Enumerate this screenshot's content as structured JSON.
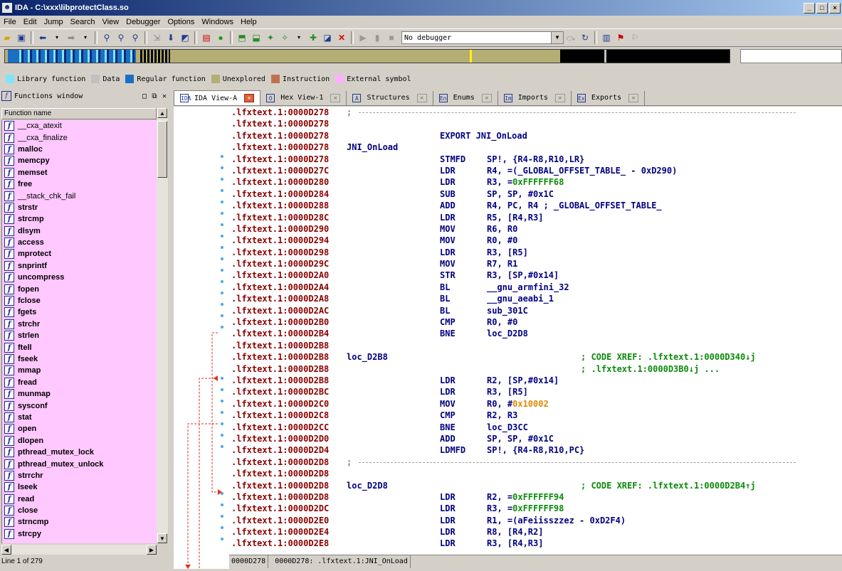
{
  "window": {
    "title": "IDA - C:\\xxx\\libprotectClass.so",
    "minimize": "_",
    "restore": "□",
    "close": "×"
  },
  "menu": [
    "File",
    "Edit",
    "Jump",
    "Search",
    "View",
    "Debugger",
    "Options",
    "Windows",
    "Help"
  ],
  "toolbar": {
    "debugger_value": "No debugger"
  },
  "legend": [
    {
      "label": "Library function",
      "color": "#7fe5ff"
    },
    {
      "label": "Data",
      "color": "#c0c0c0"
    },
    {
      "label": "Regular function",
      "color": "#1a6fc4"
    },
    {
      "label": "Unexplored",
      "color": "#b5ae74"
    },
    {
      "label": "Instruction",
      "color": "#c07050"
    },
    {
      "label": "External symbol",
      "color": "#ffb0ff"
    }
  ],
  "functions_window": {
    "title": "Functions window",
    "column_header": "Function name",
    "items": [
      "__cxa_atexit",
      "__cxa_finalize",
      "malloc",
      "memcpy",
      "memset",
      "free",
      "__stack_chk_fail",
      "strstr",
      "strcmp",
      "dlsym",
      "access",
      "mprotect",
      "snprintf",
      "uncompress",
      "fopen",
      "fclose",
      "fgets",
      "strchr",
      "strlen",
      "ftell",
      "fseek",
      "mmap",
      "fread",
      "munmap",
      "sysconf",
      "stat",
      "open",
      "dlopen",
      "pthread_mutex_lock",
      "pthread_mutex_unlock",
      "strrchr",
      "lseek",
      "read",
      "close",
      "strncmp",
      "strcpy"
    ],
    "status": "Line 1 of 279"
  },
  "tabs": [
    {
      "label": "IDA View-A",
      "icon": "IDA",
      "active": true
    },
    {
      "label": "Hex View-1",
      "icon": "O"
    },
    {
      "label": "Structures",
      "icon": "A"
    },
    {
      "label": "Enums",
      "icon": "En"
    },
    {
      "label": "Imports",
      "icon": "Im"
    },
    {
      "label": "Exports",
      "icon": "Ex"
    }
  ],
  "listing": [
    {
      "addr": ".lfxtext.1:0000D278",
      "sep": ";"
    },
    {
      "addr": ".lfxtext.1:0000D278"
    },
    {
      "addr": ".lfxtext.1:0000D278",
      "mn": "EXPORT JNI_OnLoad"
    },
    {
      "addr": ".lfxtext.1:0000D278",
      "label": "JNI_OnLoad"
    },
    {
      "addr": ".lfxtext.1:0000D278",
      "mn": "STMFD",
      "ops": "SP!, {R4-R8,R10,LR}"
    },
    {
      "addr": ".lfxtext.1:0000D27C",
      "mn": "LDR",
      "ops": "R4, =(_GLOBAL_OFFSET_TABLE_ - 0xD290)"
    },
    {
      "addr": ".lfxtext.1:0000D280",
      "mn": "LDR",
      "ops": "R3, =0xFFFFFF68"
    },
    {
      "addr": ".lfxtext.1:0000D284",
      "mn": "SUB",
      "ops": "SP, SP, #0x1C"
    },
    {
      "addr": ".lfxtext.1:0000D288",
      "mn": "ADD",
      "ops": "R4, PC, R4 ; _GLOBAL_OFFSET_TABLE_"
    },
    {
      "addr": ".lfxtext.1:0000D28C",
      "mn": "LDR",
      "ops": "R5, [R4,R3]"
    },
    {
      "addr": ".lfxtext.1:0000D290",
      "mn": "MOV",
      "ops": "R6, R0"
    },
    {
      "addr": ".lfxtext.1:0000D294",
      "mn": "MOV",
      "ops": "R0, #0"
    },
    {
      "addr": ".lfxtext.1:0000D298",
      "mn": "LDR",
      "ops": "R3, [R5]"
    },
    {
      "addr": ".lfxtext.1:0000D29C",
      "mn": "MOV",
      "ops": "R7, R1"
    },
    {
      "addr": ".lfxtext.1:0000D2A0",
      "mn": "STR",
      "ops": "R3, [SP,#0x14]"
    },
    {
      "addr": ".lfxtext.1:0000D2A4",
      "mn": "BL",
      "ops": "__gnu_armfini_32"
    },
    {
      "addr": ".lfxtext.1:0000D2A8",
      "mn": "BL",
      "ops": "__gnu_aeabi_1"
    },
    {
      "addr": ".lfxtext.1:0000D2AC",
      "mn": "BL",
      "ops": "sub_301C"
    },
    {
      "addr": ".lfxtext.1:0000D2B0",
      "mn": "CMP",
      "ops": "R0, #0"
    },
    {
      "addr": ".lfxtext.1:0000D2B4",
      "mn": "BNE",
      "ops": "loc_D2D8"
    },
    {
      "addr": ".lfxtext.1:0000D2B8"
    },
    {
      "addr": ".lfxtext.1:0000D2B8",
      "label": "loc_D2B8",
      "cmt": "; CODE XREF: .lfxtext.1:0000D340↓j"
    },
    {
      "addr": ".lfxtext.1:0000D2B8",
      "cmt": "; .lfxtext.1:0000D3B0↓j ..."
    },
    {
      "addr": ".lfxtext.1:0000D2B8",
      "mn": "LDR",
      "ops": "R2, [SP,#0x14]"
    },
    {
      "addr": ".lfxtext.1:0000D2BC",
      "mn": "LDR",
      "ops": "R3, [R5]"
    },
    {
      "addr": ".lfxtext.1:0000D2C0",
      "mn": "MOV",
      "ops": "R0, #0x10002"
    },
    {
      "addr": ".lfxtext.1:0000D2C8",
      "mn": "CMP",
      "ops": "R2, R3"
    },
    {
      "addr": ".lfxtext.1:0000D2CC",
      "mn": "BNE",
      "ops": "loc_D3CC"
    },
    {
      "addr": ".lfxtext.1:0000D2D0",
      "mn": "ADD",
      "ops": "SP, SP, #0x1C"
    },
    {
      "addr": ".lfxtext.1:0000D2D4",
      "mn": "LDMFD",
      "ops": "SP!, {R4-R8,R10,PC}"
    },
    {
      "addr": ".lfxtext.1:0000D2D8",
      "sep": ";"
    },
    {
      "addr": ".lfxtext.1:0000D2D8"
    },
    {
      "addr": ".lfxtext.1:0000D2D8",
      "label": "loc_D2D8",
      "cmt": "; CODE XREF: .lfxtext.1:0000D2B4↑j"
    },
    {
      "addr": ".lfxtext.1:0000D2D8",
      "mn": "LDR",
      "ops": "R2, =0xFFFFFF94"
    },
    {
      "addr": ".lfxtext.1:0000D2DC",
      "mn": "LDR",
      "ops": "R3, =0xFFFFFF98"
    },
    {
      "addr": ".lfxtext.1:0000D2E0",
      "mn": "LDR",
      "ops": "R1, =(aFeiisszzez - 0xD2F4)"
    },
    {
      "addr": ".lfxtext.1:0000D2E4",
      "mn": "LDR",
      "ops": "R8, [R4,R2]"
    },
    {
      "addr": ".lfxtext.1:0000D2E8",
      "mn": "LDR",
      "ops": "R3, [R4,R3]"
    }
  ],
  "status_bar": {
    "offset": "0000D278",
    "location": "0000D278: .lfxtext.1:JNI_OnLoad"
  },
  "colors": {
    "address": "#8b0000",
    "code": "#000080",
    "comment": "#0a8a0a",
    "functions_bg": "#ffc8ff"
  }
}
